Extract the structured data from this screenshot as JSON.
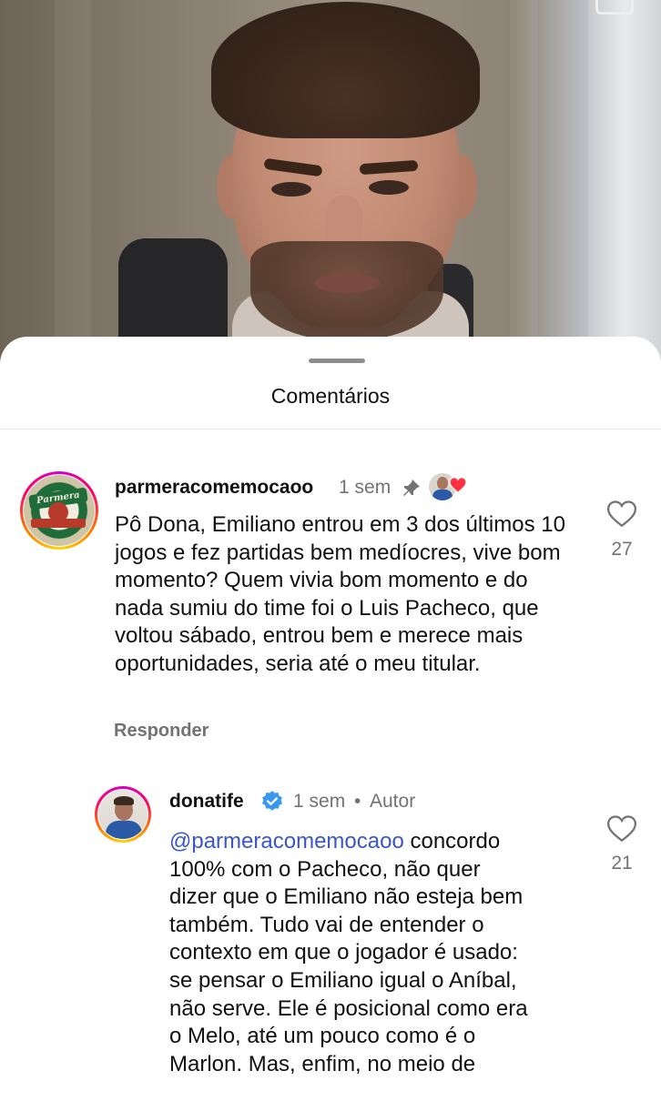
{
  "sheet": {
    "title": "Comentários"
  },
  "comments": [
    {
      "username": "parmeracomemocaoo",
      "time": "1 sem",
      "text": "Pô Dona, Emiliano entrou em 3 dos últimos 10 jogos e fez partidas bem medíocres, vive bom momento? Quem vivia bom momento e do nada sumiu do time foi o Luis Pacheco, que voltou sábado, entrou bem e merece mais oportunidades, seria até o meu titular.",
      "reply_label": "Responder",
      "likes": "27",
      "pinned_icon": "pin-icon",
      "creator_liked_icon": "heart-filled-icon"
    },
    {
      "username": "donatife",
      "time": "1 sem",
      "separator": "•",
      "author_badge": "Autor",
      "mention": "@parmeracomemocaoo",
      "text_lines": [
        " concordo",
        "100% com o Pacheco, não quer",
        "dizer que o Emiliano não esteja bem",
        "também. Tudo vai de entender o",
        "contexto em que o jogador é usado:",
        "se pensar o Emiliano igual o Aníbal,",
        "não serve. Ele é posicional como era",
        "o Melo, até um pouco como é o",
        "Marlon. Mas, enfim, no meio de"
      ],
      "likes": "21",
      "verified_icon": "verified-badge-icon"
    }
  ],
  "colors": {
    "accent_mention": "#3a56c8",
    "verified": "#3897f0",
    "heart_red": "#ff3040",
    "meta_gray": "#737373"
  }
}
